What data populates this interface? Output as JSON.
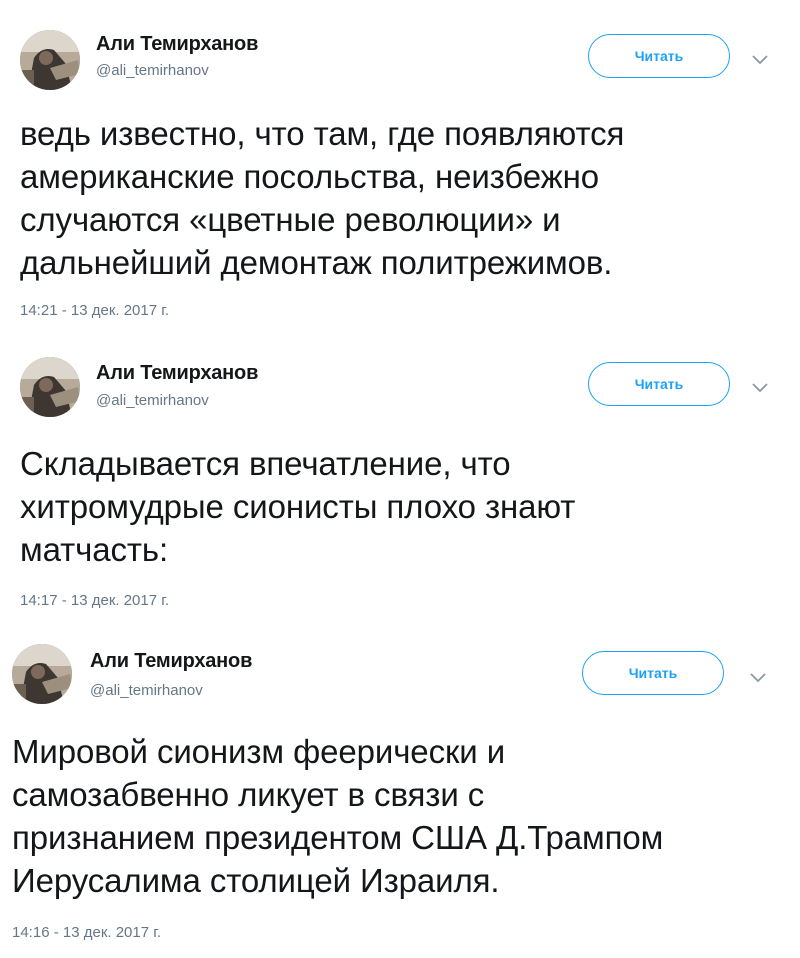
{
  "tweets": [
    {
      "author_name": "Али Темирханов",
      "author_handle": "@ali_temirhanov",
      "follow_label": "Читать",
      "text": "ведь известно, что там, где появляются\nамериканские посольства, неизбежно\nслучаются «цветные революции» и\nдальнейший демонтаж политрежимов.",
      "timestamp": "14:21 - 13 дек. 2017 г."
    },
    {
      "author_name": "Али Темирханов",
      "author_handle": "@ali_temirhanov",
      "follow_label": "Читать",
      "text": "Складывается впечатление, что\nхитромудрые сионисты  плохо знают\nматчасть:",
      "timestamp": "14:17 - 13 дек. 2017 г."
    },
    {
      "author_name": "Али Темирханов",
      "author_handle": "@ali_temirhanov",
      "follow_label": "Читать",
      "text": "Мировой сионизм феерически и\nсамозабвенно ликует в связи с\nпризнанием президентом США Д.Трампом\nИерусалима столицей Израиля.",
      "timestamp": "14:16 - 13 дек. 2017 г."
    }
  ],
  "colors": {
    "accent": "#1da1f2",
    "secondary_text": "#657786",
    "primary_text": "#14171a"
  },
  "icons": {
    "avatar": "avatar-photo",
    "caret": "chevron-down-icon"
  }
}
